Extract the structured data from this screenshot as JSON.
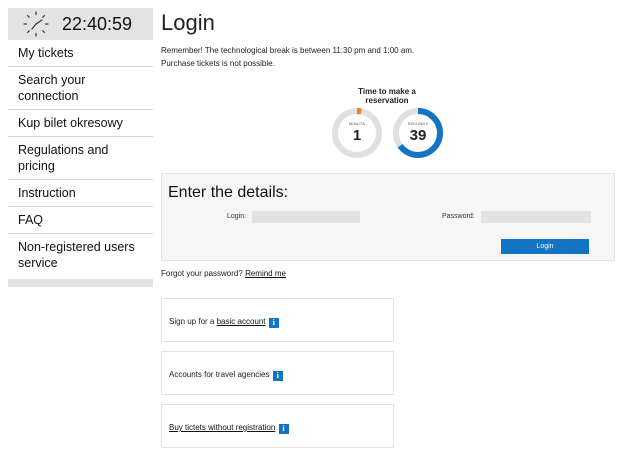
{
  "clock": {
    "time": "22:40:59"
  },
  "sidebar": {
    "items": [
      {
        "label": "My tickets"
      },
      {
        "label": "Search your connection"
      },
      {
        "label": "Kup bilet okresowy"
      },
      {
        "label": "Regulations and pricing"
      },
      {
        "label": "Instruction"
      },
      {
        "label": "FAQ"
      },
      {
        "label": "Non-registered users service"
      }
    ]
  },
  "main": {
    "title": "Login",
    "notice_line1": "Remember! The technological break is between 11:30 pm and 1:00 am.",
    "notice_line2": "Purchase tickets is not possible."
  },
  "timer": {
    "title": "Time to make a reservation",
    "minutes": {
      "label": "MINUTA",
      "value": "1",
      "fraction": 0.03,
      "color": "#f07f1e"
    },
    "seconds": {
      "label": "SEKUNDY",
      "value": "39",
      "fraction": 0.65,
      "color": "#1474c4"
    }
  },
  "details": {
    "title": "Enter the details:",
    "login_label": "Login:",
    "login_value": "",
    "password_label": "Password:",
    "password_value": "",
    "login_button": "Login"
  },
  "forgot": {
    "text": "Forgot your password?",
    "link": "Remind me"
  },
  "boxes": [
    {
      "before": "Sign up for a ",
      "link": "basic account",
      "after": ""
    },
    {
      "before": "Accounts for travel agencies",
      "link": "",
      "after": ""
    },
    {
      "before": "",
      "link": "Buy tictets without registration",
      "after": ""
    }
  ],
  "colors": {
    "accent": "#1474c4",
    "orange": "#f07f1e",
    "sidebar_bg": "#e3e3e3"
  },
  "icons": {
    "clock": "clock-icon",
    "info": "info-icon"
  }
}
